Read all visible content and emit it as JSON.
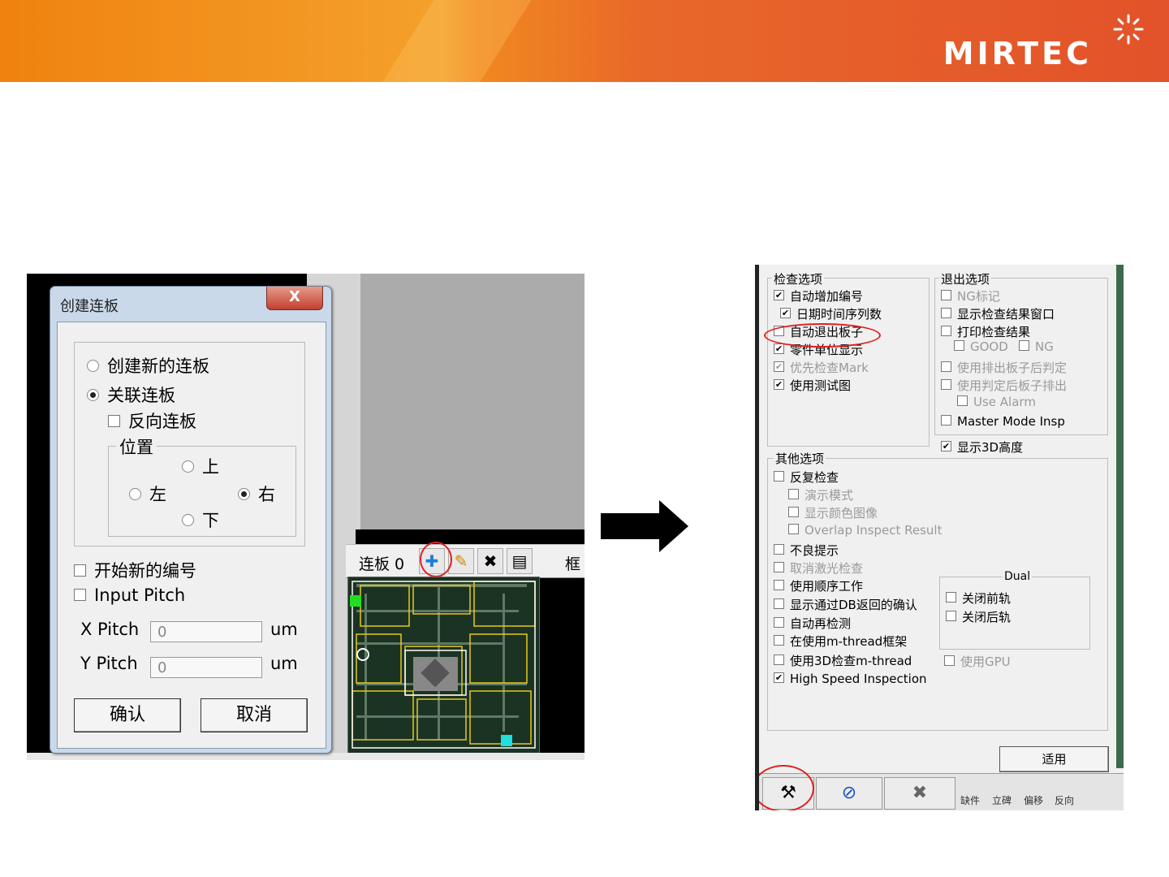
{
  "header": {
    "logo_text": "MIRTEC",
    "colors": {
      "orange": "#f0820f",
      "red_orange": "#e3522a"
    }
  },
  "left_panel": {
    "dialog": {
      "title": "创建连板",
      "close_label": "X",
      "radio_new": "创建新的连板",
      "radio_link": "关联连板",
      "reverse_checkbox": "反向连板",
      "position_group": "位置",
      "pos_up": "上",
      "pos_left": "左",
      "pos_right": "右",
      "pos_down": "下",
      "start_numbering": "开始新的编号",
      "input_pitch": "Input Pitch",
      "x_pitch_label": "X Pitch",
      "x_pitch_value": "0",
      "x_unit": "um",
      "y_pitch_label": "Y Pitch",
      "y_pitch_value": "0",
      "y_unit": "um",
      "ok_button": "确认",
      "cancel_button": "取消"
    },
    "toolbar": {
      "label": "连板 0",
      "add_icon": "plus-icon",
      "edit_icon": "edit-icon",
      "delete_icon": "delete-icon",
      "frame_icon": "frame-icon",
      "trailing_label": "框"
    }
  },
  "arrow": {
    "icon": "right-arrow-icon"
  },
  "right_panel": {
    "inspect_group": {
      "title": "检查选项",
      "items": [
        {
          "label": "自动增加编号",
          "checked": true,
          "disabled": false
        },
        {
          "label": "日期时间序列数",
          "checked": true,
          "disabled": false
        },
        {
          "label": "自动退出板子",
          "checked": false,
          "disabled": false
        },
        {
          "label": "零件单位显示",
          "checked": true,
          "disabled": false
        },
        {
          "label": "优先检查Mark",
          "checked": true,
          "disabled": true
        },
        {
          "label": "使用测试图",
          "checked": true,
          "disabled": false
        }
      ]
    },
    "exit_group": {
      "title": "退出选项",
      "items": [
        {
          "label": "NG标记",
          "checked": false,
          "disabled": true
        },
        {
          "label": "显示检查结果窗口",
          "checked": false,
          "disabled": false
        },
        {
          "label": "打印检查结果",
          "checked": false,
          "disabled": false
        },
        {
          "label": "GOOD",
          "checked": false,
          "disabled": true
        },
        {
          "label": "NG",
          "checked": false,
          "disabled": true
        },
        {
          "label": "使用排出板子后判定",
          "checked": false,
          "disabled": true
        },
        {
          "label": "使用判定后板子排出",
          "checked": false,
          "disabled": true
        },
        {
          "label": "Use Alarm",
          "checked": false,
          "disabled": true
        },
        {
          "label": "Master Mode Insp",
          "checked": false,
          "disabled": false
        }
      ]
    },
    "show_3d": {
      "label": "显示3D高度",
      "checked": true
    },
    "other_group": {
      "title": "其他选项",
      "items": [
        {
          "label": "反复检查",
          "checked": false,
          "disabled": false
        },
        {
          "label": "演示模式",
          "checked": false,
          "disabled": true
        },
        {
          "label": "显示颜色图像",
          "checked": false,
          "disabled": true
        },
        {
          "label": "Overlap Inspect Result",
          "checked": false,
          "disabled": true
        },
        {
          "label": "不良提示",
          "checked": false,
          "disabled": false
        },
        {
          "label": "取消激光检查",
          "checked": false,
          "disabled": true
        },
        {
          "label": "使用顺序工作",
          "checked": false,
          "disabled": false
        },
        {
          "label": "显示通过DB返回的确认",
          "checked": false,
          "disabled": false
        },
        {
          "label": "自动再检测",
          "checked": false,
          "disabled": false
        },
        {
          "label": "在使用m-thread框架",
          "checked": false,
          "disabled": false
        },
        {
          "label": "使用3D检查m-thread",
          "checked": false,
          "disabled": false
        },
        {
          "label": "High Speed Inspection",
          "checked": true,
          "disabled": false
        }
      ]
    },
    "dual_group": {
      "title": "Dual",
      "items": [
        {
          "label": "关闭前轨",
          "checked": false
        },
        {
          "label": "关闭后轨",
          "checked": false
        }
      ]
    },
    "use_gpu": {
      "label": "使用GPU",
      "checked": false,
      "disabled": true
    },
    "apply_button": "适用",
    "bottom_tabs": [
      "缺件",
      "立碑",
      "偏移",
      "反向"
    ]
  }
}
